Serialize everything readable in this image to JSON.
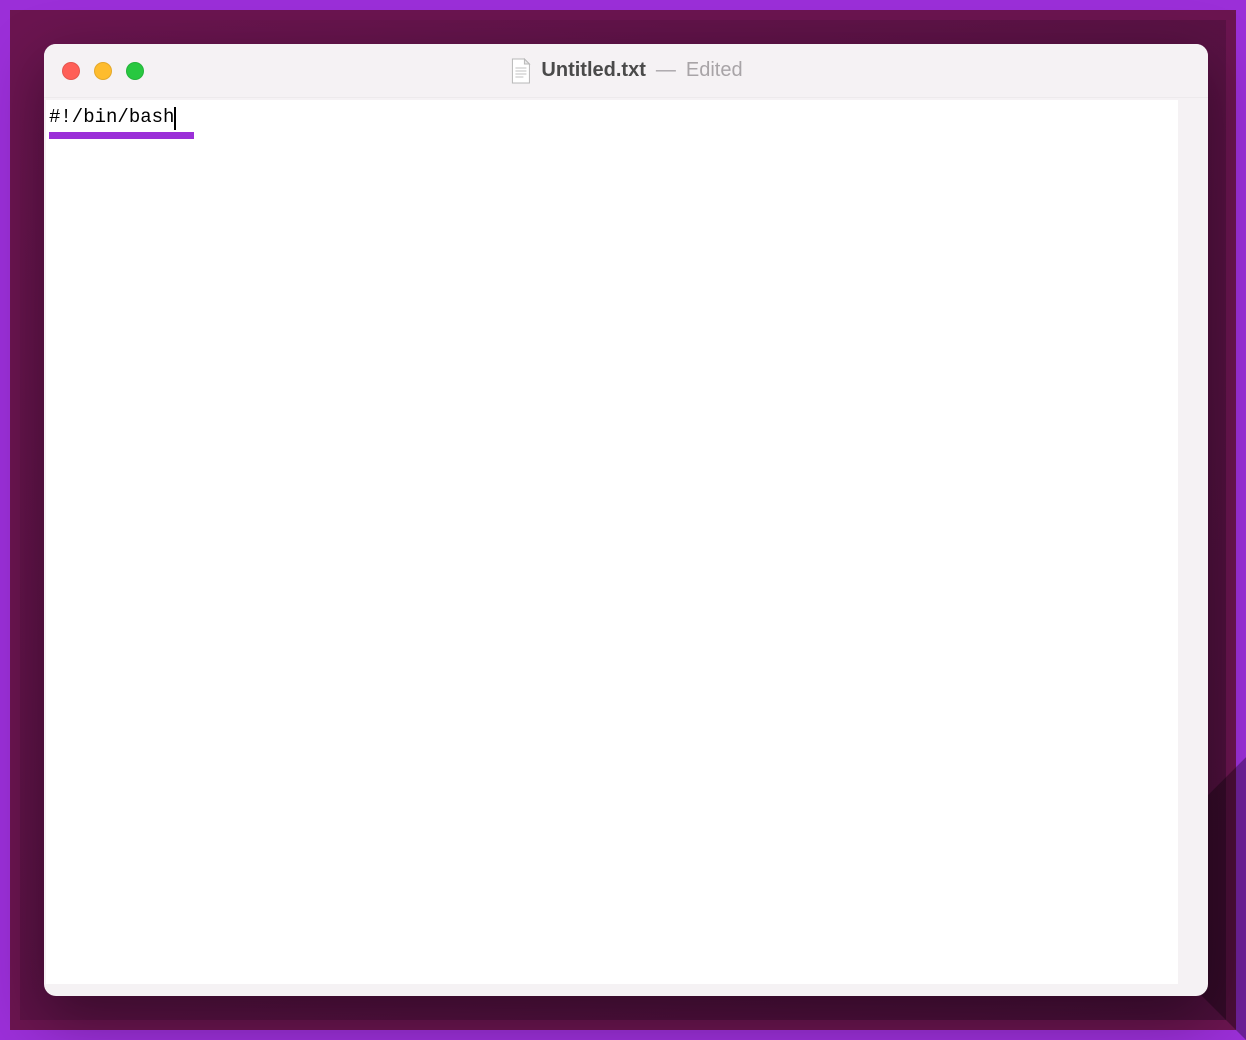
{
  "window": {
    "filename": "Untitled.txt",
    "status_separator": "—",
    "status": "Edited"
  },
  "traffic_lights": {
    "close_color": "#ff5f57",
    "minimize_color": "#febc2e",
    "zoom_color": "#28c840"
  },
  "editor": {
    "content": "#!/bin/bash"
  }
}
